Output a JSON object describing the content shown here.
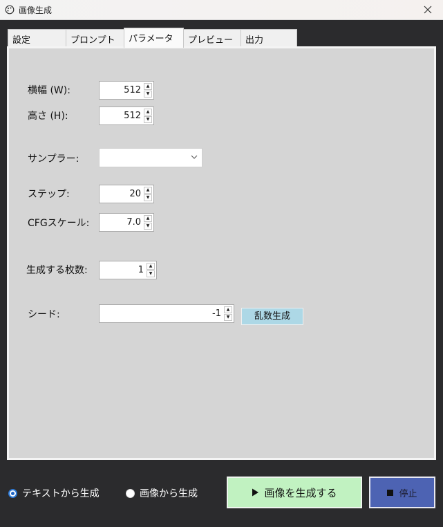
{
  "window": {
    "title": "画像生成"
  },
  "tabs": [
    {
      "label": "設定"
    },
    {
      "label": "プロンプト"
    },
    {
      "label": "パラメータ",
      "active": true
    },
    {
      "label": "プレビュー"
    },
    {
      "label": "出力"
    }
  ],
  "params": {
    "width": {
      "label": "横幅 (W):",
      "value": "512"
    },
    "height": {
      "label": "高さ (H):",
      "value": "512"
    },
    "sampler": {
      "label": "サンプラー:",
      "value": ""
    },
    "steps": {
      "label": "ステップ:",
      "value": "20"
    },
    "cfg": {
      "label": "CFGスケール:",
      "value": "7.0"
    },
    "count": {
      "label": "生成する枚数:",
      "value": "1"
    },
    "seed": {
      "label": "シード:",
      "value": "-1",
      "random_label": "乱数生成"
    }
  },
  "mode": {
    "text_label": "テキストから生成",
    "image_label": "画像から生成",
    "selected": "text"
  },
  "actions": {
    "generate_label": "画像を生成する",
    "generate_icon": "play-icon",
    "stop_label": "停止",
    "stop_icon": "stop-icon"
  },
  "colors": {
    "panel_bg": "#d5d5d5",
    "generate_bg": "#c1f2c1",
    "stop_bg": "#4d63b3",
    "random_bg": "#add8e6"
  }
}
